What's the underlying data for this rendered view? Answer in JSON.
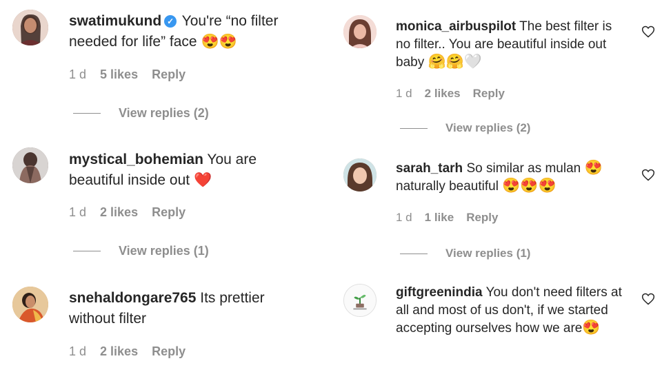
{
  "left": [
    {
      "username": "swatimukund",
      "verified": true,
      "text": "You're “no filter needed for life” face",
      "emojis": "😍😍",
      "time": "1 d",
      "likes": "5 likes",
      "reply": "Reply",
      "view_replies": "View replies (2)",
      "avatar_color": "#8a5a48"
    },
    {
      "username": "mystical_bohemian",
      "verified": false,
      "text": "You are beautiful inside out",
      "emojis": "❤️",
      "time": "1 d",
      "likes": "2 likes",
      "reply": "Reply",
      "view_replies": "View replies (1)",
      "avatar_color": "#6d5a55"
    },
    {
      "username": "snehaldongare765",
      "verified": false,
      "text": "Its prettier without filter",
      "emojis": "",
      "time": "1 d",
      "likes": "2 likes",
      "reply": "Reply",
      "view_replies": "",
      "avatar_color": "#c68a3a"
    }
  ],
  "right": [
    {
      "username": "monica_airbuspilot",
      "text": "The best filter is no filter.. You are beautiful inside out baby",
      "emojis": "🤗🤗🤍",
      "time": "1 d",
      "likes": "2 likes",
      "reply": "Reply",
      "view_replies": "View replies (2)",
      "avatar_color": "#d9a69a"
    },
    {
      "username": "sarah_tarh",
      "text": "So similar as mulan",
      "emojis_inline": "😍",
      "text2": "naturally beautiful",
      "emojis": "😍😍😍",
      "time": "1 d",
      "likes": "1 like",
      "reply": "Reply",
      "view_replies": "View replies (1)",
      "avatar_color": "#a88a7a"
    },
    {
      "username": "giftgreenindia",
      "text": "You don't need filters at all and most of us don't, if we started accepting ourselves how we are",
      "emojis": "😍",
      "avatar_color": "#f2f2f2"
    }
  ],
  "colors": {
    "text": "#262626",
    "meta": "#8e8e8e",
    "verified": "#3897f0"
  },
  "icons": [
    "verified-badge-icon",
    "heart-outline-icon",
    "view-replies-line"
  ]
}
